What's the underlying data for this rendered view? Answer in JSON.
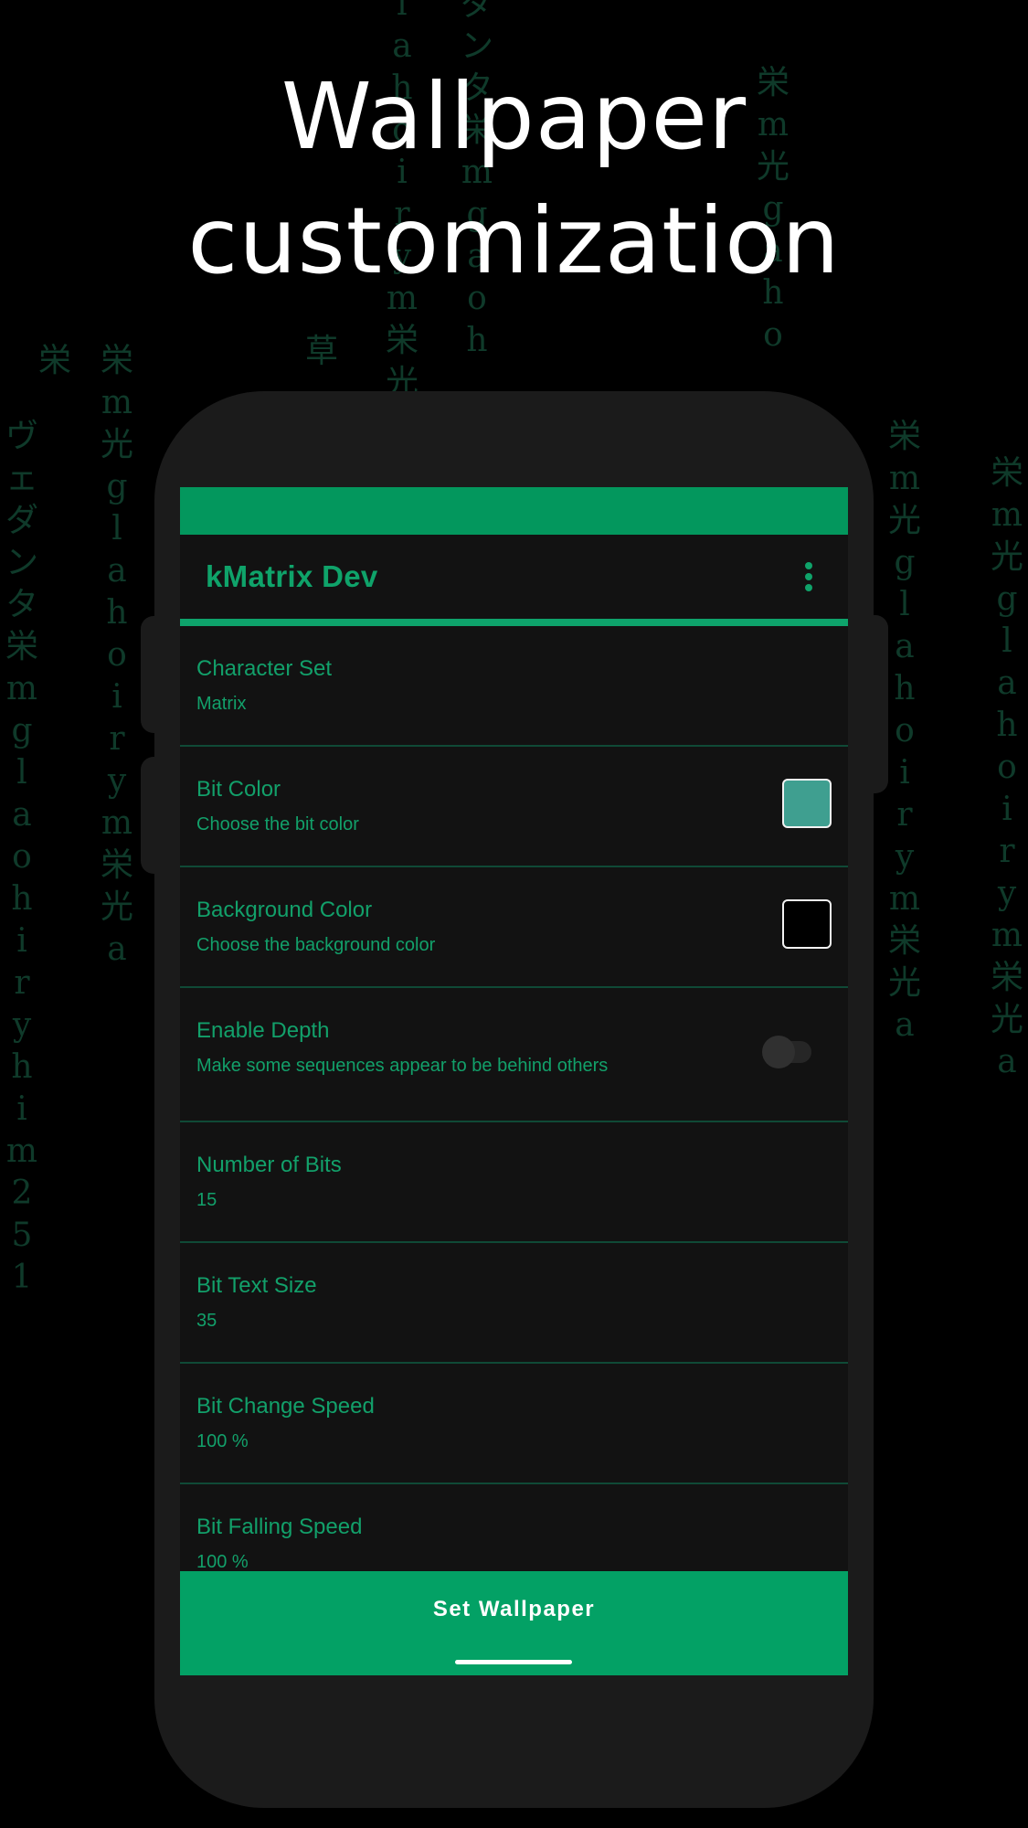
{
  "headline": {
    "line1": "Wallpaper",
    "line2": "customization"
  },
  "background_rain": [
    "ヴ\nェ\nダ\nン\nタ\n栄\nm\ng\nl\na\no\nh\ni\nr\ny\nh\ni\nm\n2\n5\n1",
    "栄\nm\n光\ng\nl\na\nh\no\ni\nr\ny\nm\n栄\n光\na",
    "栄",
    "草",
    "l\na\nh\no\ni\nr\ny\nm\n栄\n光",
    "ダ\nン\nタ\n栄\nm\ng\na\no\nh",
    "栄\nm\n光\ng\na\nh\no",
    "栄\nm\n光\ng\nl\na\nh\no\ni\nr\ny\nm\n栄\n光\na",
    "栄\nm\n光\ng\nl\na\nh\no\ni\nr\ny\nm\n栄\n光\na"
  ],
  "app": {
    "title": "kMatrix Dev",
    "menu_icon": "more-vert-icon",
    "accent_color": "#03975d"
  },
  "preferences": [
    {
      "title": "Character Set",
      "summary": "Matrix"
    },
    {
      "title": "Bit Color",
      "summary": "Choose the bit color",
      "color": "#3f9f90"
    },
    {
      "title": "Background Color",
      "summary": "Choose the background color",
      "color": "#000000"
    },
    {
      "title": "Enable Depth",
      "summary": "Make some sequences appear to be behind others",
      "enabled": false
    },
    {
      "title": "Number of Bits",
      "summary": "15"
    },
    {
      "title": "Bit Text Size",
      "summary": "35"
    },
    {
      "title": "Bit Change Speed",
      "summary": "100 %"
    },
    {
      "title": "Bit Falling Speed",
      "summary": "100 %"
    }
  ],
  "actions": {
    "set_wallpaper": "Set Wallpaper"
  }
}
